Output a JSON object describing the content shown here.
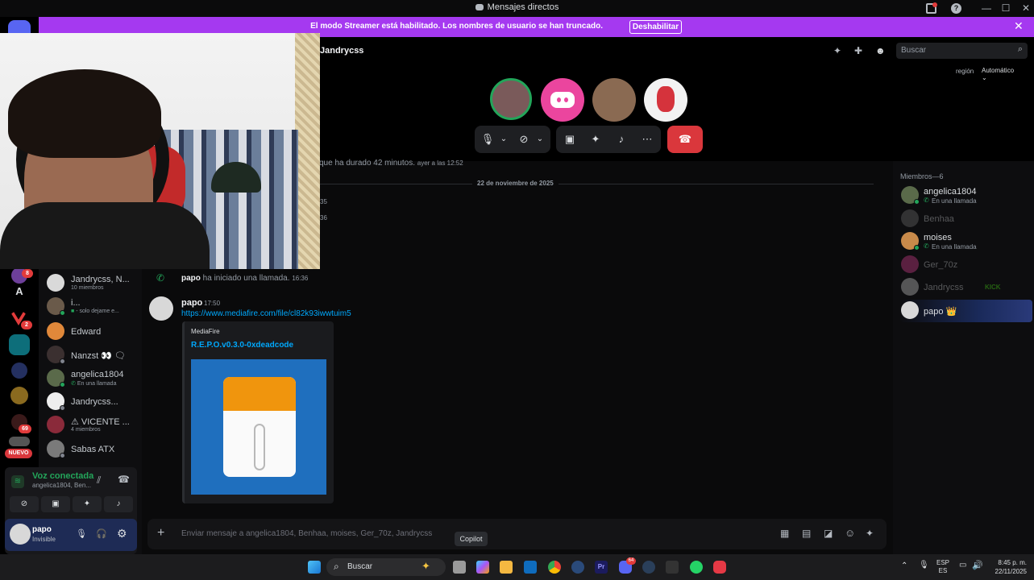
{
  "window": {
    "title": "Mensajes directos"
  },
  "banner": {
    "text": "El modo Streamer está habilitado. Los nombres de usuario se han truncado.",
    "button": "Deshabilitar"
  },
  "header": {
    "channel": "Jandrycss",
    "search_placeholder": "Buscar",
    "region_label": "región",
    "region_value": "Automático"
  },
  "rail": {
    "badges": [
      "8",
      "2",
      "69"
    ],
    "letter": "A",
    "new_badge": "NUEVO"
  },
  "dms": [
    {
      "name": "Jandrycss, N...",
      "sub": "10 miembros"
    },
    {
      "name": "i...",
      "sub": "- solo dejame e..."
    },
    {
      "name": "Edward",
      "sub": ""
    },
    {
      "name": "Nanzst 👀 🗨",
      "sub": ""
    },
    {
      "name": "angelica1804",
      "sub": "En una llamada"
    },
    {
      "name": "Jandrycss...",
      "sub": ""
    },
    {
      "name": "⚠ VICENTE ...",
      "sub": "4 miembros"
    },
    {
      "name": "Sabas ATX",
      "sub": ""
    }
  ],
  "voice": {
    "status": "Voz conectada",
    "channel": "angelica1804, Ben..."
  },
  "user": {
    "name": "papo",
    "status": "Invisible"
  },
  "messages": {
    "system_tail": "que ha durado 42 minutos.",
    "system_tail_time": "ayer a las 12:52",
    "date_divider": "22 de noviembre de 2025",
    "frag1": "35",
    "frag2": "36",
    "call_user": "papo",
    "call_text": "ha iniciado una llamada.",
    "call_time": "16:36",
    "msg_user": "papo",
    "msg_time": "17:50",
    "msg_link": "https://www.mediafire.com/file/cl82k93iwwtuim5",
    "embed_provider": "MediaFire",
    "embed_title": "R.E.P.O.v0.3.0-0xdeadcode"
  },
  "composer": {
    "placeholder": "Enviar mensaje a angelica1804, Benhaa, moises, Ger_70z, Jandrycss",
    "tooltip": "Copilot"
  },
  "members": {
    "header": "Miembros—6",
    "list": [
      {
        "name": "angelica1804",
        "sub": "En una llamada",
        "dim": false
      },
      {
        "name": "Benhaa",
        "sub": "",
        "dim": true
      },
      {
        "name": "moises",
        "sub": "En una llamada",
        "dim": false
      },
      {
        "name": "Ger_70z",
        "sub": "",
        "dim": true
      },
      {
        "name": "Jandrycss",
        "sub": "KICK",
        "dim": true
      },
      {
        "name": "papo 👑",
        "sub": "",
        "dim": false
      }
    ]
  },
  "taskbar": {
    "search": "Buscar",
    "lang": "ESP",
    "region": "ES",
    "time": "8:45 p. m.",
    "date": "22/11/2025",
    "discord_badge": "64"
  },
  "colors": {
    "banner": "#a539f0",
    "blurple": "#5865f2",
    "hangup": "#da373c",
    "link": "#00a8fc",
    "online": "#23a55a"
  }
}
